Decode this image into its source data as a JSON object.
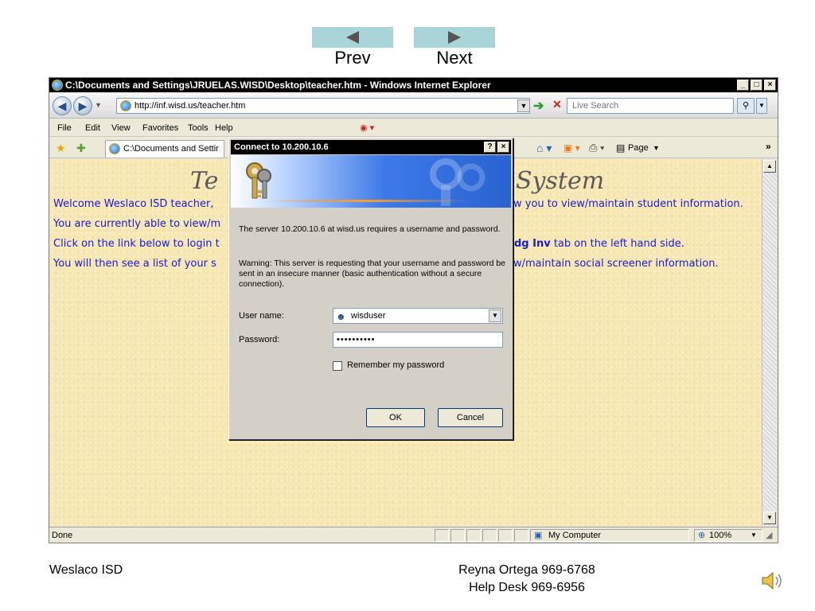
{
  "slide_nav": {
    "prev_label": "Prev",
    "next_label": "Next"
  },
  "window": {
    "title": "C:\\Documents and Settings\\JRUELAS.WISD\\Desktop\\teacher.htm - Windows Internet Explorer",
    "address": "http://inf.wisd.us/teacher.htm",
    "search_placeholder": "Live Search",
    "menu": [
      "File",
      "Edit",
      "View",
      "Favorites",
      "Tools",
      "Help"
    ],
    "tab_title": "C:\\Documents and Settir",
    "page_menu": "Page",
    "status": "Done",
    "zone": "My Computer",
    "zoom": "100%"
  },
  "page": {
    "heading_left": "Te",
    "heading_right": "System",
    "lines_left": [
      "Welcome Weslaco ISD teacher,",
      "You are currently able to view/m",
      "Click on the link below to login t",
      "You will then see a list of your s"
    ],
    "line1_right": "w you to view/maintain student information.",
    "line3_right_bold": "dg Inv",
    "line3_right_rest": " tab on the left hand side.",
    "line4_right": "w/maintain social screener information."
  },
  "dialog": {
    "title": "Connect to 10.200.10.6",
    "message": "The server 10.200.10.6 at wisd.us requires a username and password.",
    "warning": "Warning: This server is requesting that your username and password be sent in an insecure manner (basic authentication without a secure connection).",
    "username_label": "User name:",
    "username_value": "wisduser",
    "password_label": "Password:",
    "password_value": "••••••••••",
    "remember_label": "Remember my password",
    "ok_label": "OK",
    "cancel_label": "Cancel"
  },
  "footer": {
    "left": "Weslaco ISD",
    "contact_line1": "Reyna Ortega  969-6768",
    "contact_line2": "Help Desk 969-6956"
  }
}
